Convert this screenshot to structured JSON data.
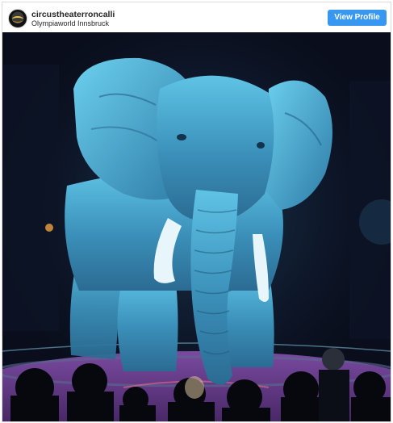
{
  "post": {
    "username": "circustheaterroncalli",
    "location": "Olympiaworld Innsbruck",
    "view_profile_label": "View Profile"
  },
  "photo": {
    "subject": "holographic elephant projected in a circus ring",
    "colors": {
      "background": "#0a0e1c",
      "hologram": "#4fb6d8",
      "floor": "#6a3f8a",
      "button": "#3897f0"
    }
  },
  "icons": {
    "avatar": "circus-logo-avatar"
  }
}
